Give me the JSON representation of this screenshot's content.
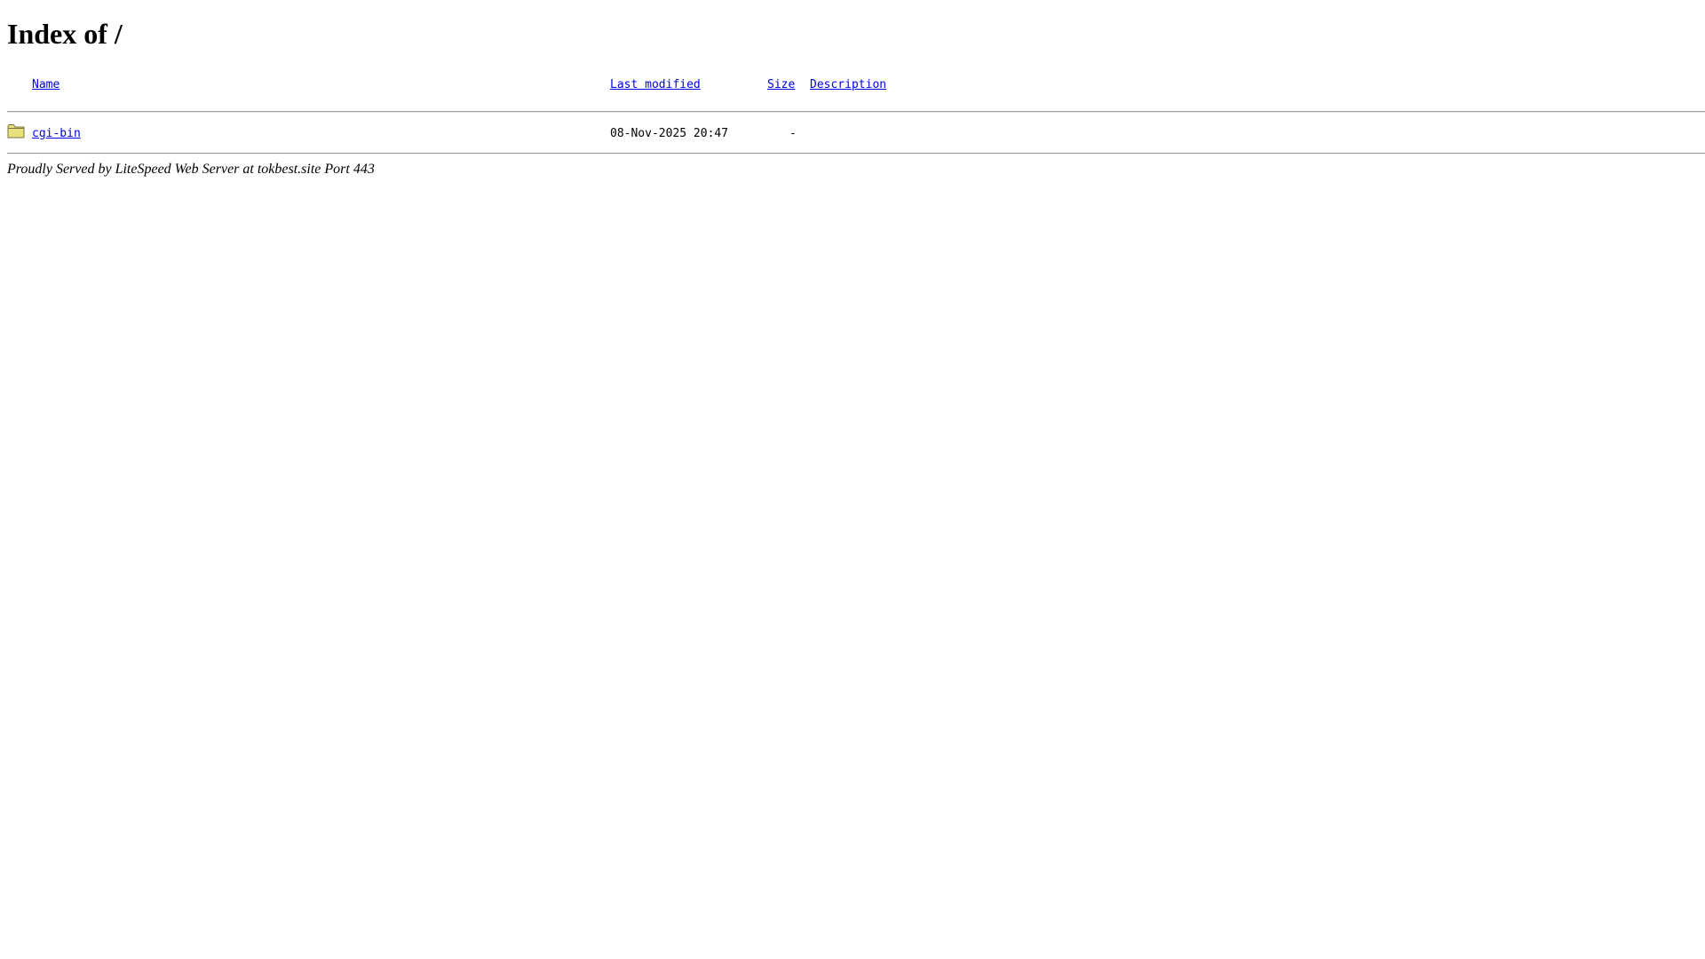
{
  "page": {
    "title": "Index of /"
  },
  "table": {
    "columns": {
      "name": "Name",
      "last_modified": "Last modified",
      "size": "Size",
      "description": "Description"
    },
    "rows": [
      {
        "icon": "folder-icon",
        "name": "cgi-bin",
        "last_modified": "08-Nov-2025 20:47",
        "size": "-",
        "description": ""
      }
    ]
  },
  "footer": {
    "text": "Proudly Served by LiteSpeed Web Server at tokbest.site Port 443"
  },
  "colors": {
    "link": "#0000ee",
    "folder_fill": "#e8e07a",
    "folder_stroke": "#7a7440"
  }
}
